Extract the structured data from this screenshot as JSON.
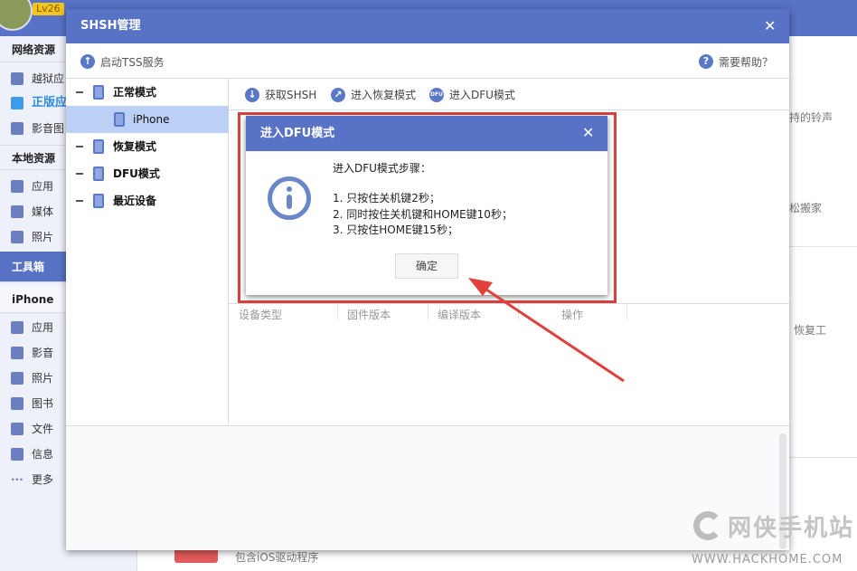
{
  "app": {
    "level_badge": "Lv26"
  },
  "sidebar": {
    "sections": [
      {
        "label": "网络资源",
        "items": [
          {
            "label": "越狱应",
            "icon": "pp-icon"
          },
          {
            "label": "正版应",
            "icon": "store-icon",
            "active": true
          },
          {
            "label": "影音图",
            "icon": "music-icon"
          }
        ]
      },
      {
        "label": "本地资源",
        "items": [
          {
            "label": "应用",
            "icon": "grid-icon"
          },
          {
            "label": "媒体",
            "icon": "video-icon"
          },
          {
            "label": "照片",
            "icon": "photo-icon"
          }
        ]
      },
      {
        "label": "工具箱",
        "selected": true,
        "items": []
      },
      {
        "label": "iPhone",
        "items": [
          {
            "label": "应用",
            "icon": "grid-icon"
          },
          {
            "label": "影音",
            "icon": "video-icon"
          },
          {
            "label": "照片",
            "icon": "photo-icon"
          },
          {
            "label": "图书",
            "icon": "book-icon"
          },
          {
            "label": "文件",
            "icon": "file-icon"
          },
          {
            "label": "信息",
            "icon": "message-icon"
          },
          {
            "label": "更多",
            "icon": "more-icon"
          }
        ]
      }
    ]
  },
  "background_main": {
    "snippets": [
      "持的铃声",
      "松搬家",
      "恢复工",
      "包含iOS驱动程序"
    ]
  },
  "shsh_dialog": {
    "title": "SHSH管理",
    "start_tss": "启动TSS服务",
    "help": "需要帮助？",
    "tree": [
      {
        "label": "正常模式"
      },
      {
        "label": "iPhone",
        "child": true,
        "selected": true
      },
      {
        "label": "恢复模式"
      },
      {
        "label": "DFU模式"
      },
      {
        "label": "最近设备"
      }
    ],
    "toolbar": [
      {
        "label": "获取SHSH",
        "icon": "download-icon"
      },
      {
        "label": "进入恢复模式",
        "icon": "recovery-icon"
      },
      {
        "label": "进入DFU模式",
        "icon": "dfu-icon"
      }
    ],
    "columns": [
      "设备类型",
      "固件版本",
      "编译版本",
      "操作"
    ]
  },
  "dfu_dialog": {
    "title": "进入DFU模式",
    "heading": "进入DFU模式步骤：",
    "steps": [
      "1. 只按住关机键2秒；",
      "2. 同时按住关机键和HOME键10秒；",
      "3. 只按住HOME键15秒；"
    ],
    "ok_label": "确定"
  },
  "watermark": {
    "cn": "网侠手机站",
    "en": "WWW.HACKHOME.COM"
  },
  "colors": {
    "accent": "#5872c6",
    "highlight": "#d9403f",
    "selected_row": "#bcd0f5"
  }
}
